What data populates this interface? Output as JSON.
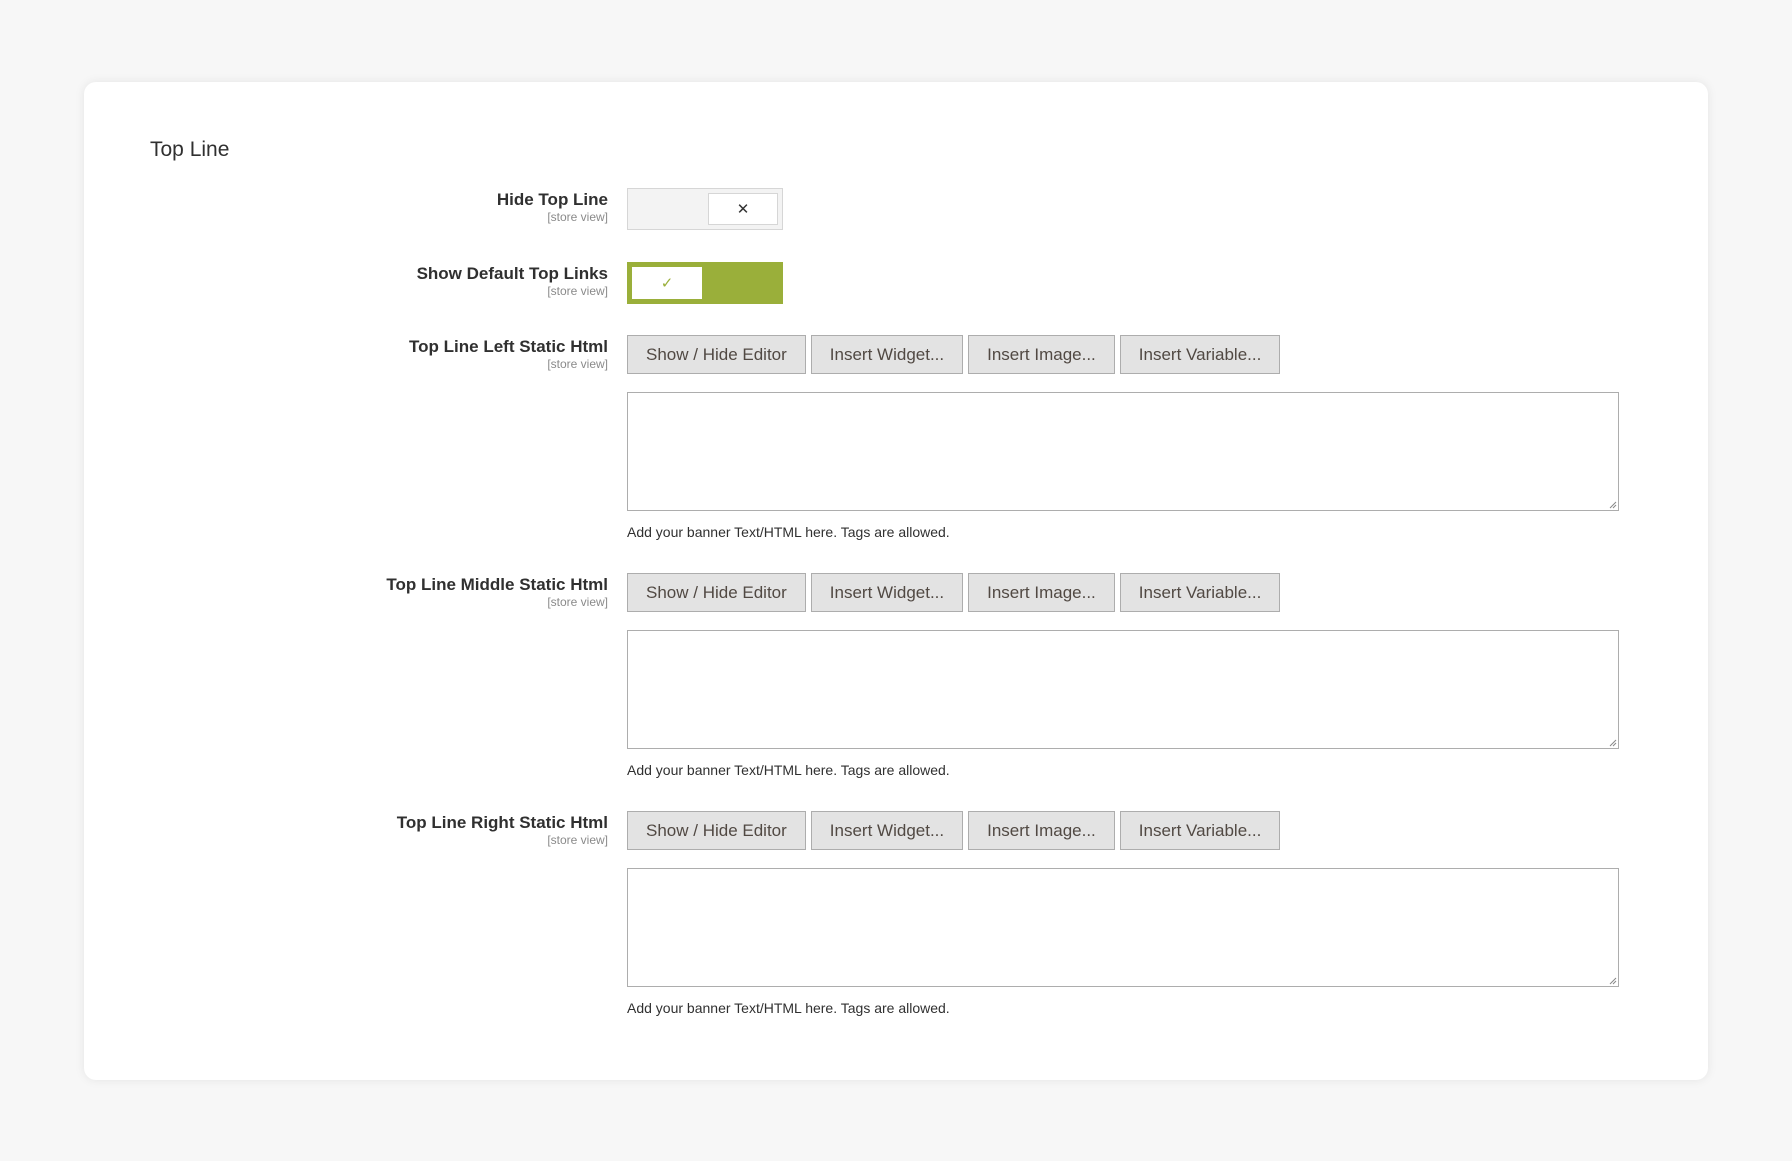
{
  "section": {
    "title": "Top Line"
  },
  "fields": {
    "hide_top_line": {
      "label": "Hide Top Line",
      "scope": "[store view]",
      "state": "off",
      "icon": "x-icon",
      "glyph": "✕"
    },
    "show_default_top_links": {
      "label": "Show Default Top Links",
      "scope": "[store view]",
      "state": "on",
      "icon": "check-icon",
      "glyph": "✓",
      "accent_color": "#9aaf3a"
    },
    "left_html": {
      "label": "Top Line Left Static Html",
      "scope": "[store view]",
      "buttons": {
        "show_hide": "Show / Hide Editor",
        "widget": "Insert Widget...",
        "image": "Insert Image...",
        "variable": "Insert Variable..."
      },
      "value": "",
      "note": "Add your banner Text/HTML here. Tags are allowed."
    },
    "middle_html": {
      "label": "Top Line Middle Static Html",
      "scope": "[store view]",
      "buttons": {
        "show_hide": "Show / Hide Editor",
        "widget": "Insert Widget...",
        "image": "Insert Image...",
        "variable": "Insert Variable..."
      },
      "value": "",
      "note": "Add your banner Text/HTML here. Tags are allowed."
    },
    "right_html": {
      "label": "Top Line Right Static Html",
      "scope": "[store view]",
      "buttons": {
        "show_hide": "Show / Hide Editor",
        "widget": "Insert Widget...",
        "image": "Insert Image...",
        "variable": "Insert Variable..."
      },
      "value": "",
      "note": "Add your banner Text/HTML here. Tags are allowed."
    }
  }
}
